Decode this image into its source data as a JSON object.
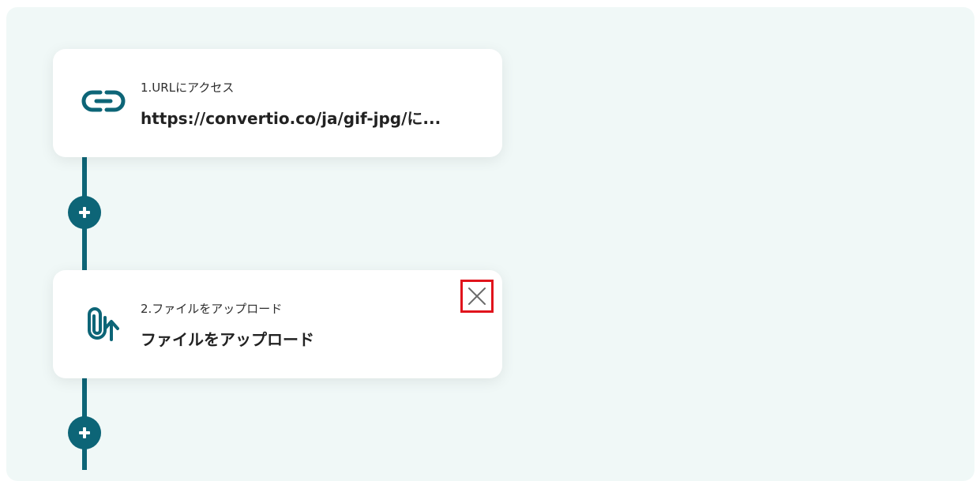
{
  "flow": {
    "steps": [
      {
        "subtitle": "1.URLにアクセス",
        "title": "https://convertio.co/ja/gif-jpg/に...",
        "icon": "link-icon"
      },
      {
        "subtitle": "2.ファイルをアップロード",
        "title": "ファイルをアップロード",
        "icon": "paperclip-upload-icon"
      }
    ]
  },
  "colors": {
    "canvas_background": "#f0f8f7",
    "accent": "#0d6577",
    "highlight": "#e0141c"
  }
}
